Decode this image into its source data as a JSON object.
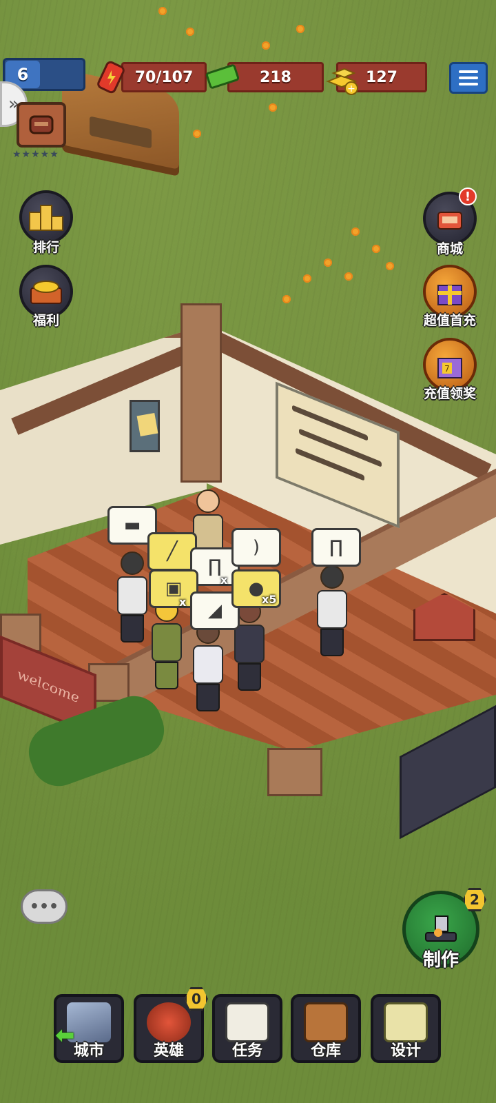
{
  "hud": {
    "level": "6",
    "energy": "70/107",
    "cash": "218",
    "gold": "127"
  },
  "player": {
    "stars": "★★★★★"
  },
  "side_left": {
    "items": [
      {
        "label": "排行",
        "icon": "ranking-podium-icon"
      },
      {
        "label": "福利",
        "icon": "gold-chest-icon"
      }
    ]
  },
  "side_right": {
    "items": [
      {
        "label": "商城",
        "icon": "shop-cart-icon"
      },
      {
        "label": "超值首充",
        "icon": "purple-gift-icon"
      },
      {
        "label": "充值领奖",
        "icon": "gift-box-7-icon"
      }
    ],
    "shop_alert": "!"
  },
  "scene": {
    "welcome_mat": "welcome",
    "items": [
      {
        "icon": "rifle-icon",
        "qty": ""
      },
      {
        "icon": "club-icon",
        "qty": ""
      },
      {
        "icon": "pants-icon",
        "qty": "x"
      },
      {
        "icon": "bow-icon",
        "qty": ""
      },
      {
        "icon": "armor-vest-icon",
        "qty": "x"
      },
      {
        "icon": "machete-icon",
        "qty": ""
      },
      {
        "icon": "grenade-icon",
        "qty": "x5"
      },
      {
        "icon": "pants-icon",
        "qty": ""
      }
    ]
  },
  "chat": {
    "label": "•••"
  },
  "craft": {
    "label": "制作",
    "badge": "2"
  },
  "bottom_nav": {
    "items": [
      {
        "label": "城市",
        "icon": "city-icon"
      },
      {
        "label": "英雄",
        "icon": "hero-helmet-icon",
        "badge": "0"
      },
      {
        "label": "任务",
        "icon": "clipboard-icon"
      },
      {
        "label": "仓库",
        "icon": "crate-icon"
      },
      {
        "label": "设计",
        "icon": "blueprint-icon"
      }
    ]
  },
  "colors": {
    "grass": "#6b8a39",
    "hud_red": "#9a3a2e",
    "accent_blue": "#2e6fc4",
    "craft_green": "#2f8a3c",
    "badge_yellow": "#f3c530"
  }
}
